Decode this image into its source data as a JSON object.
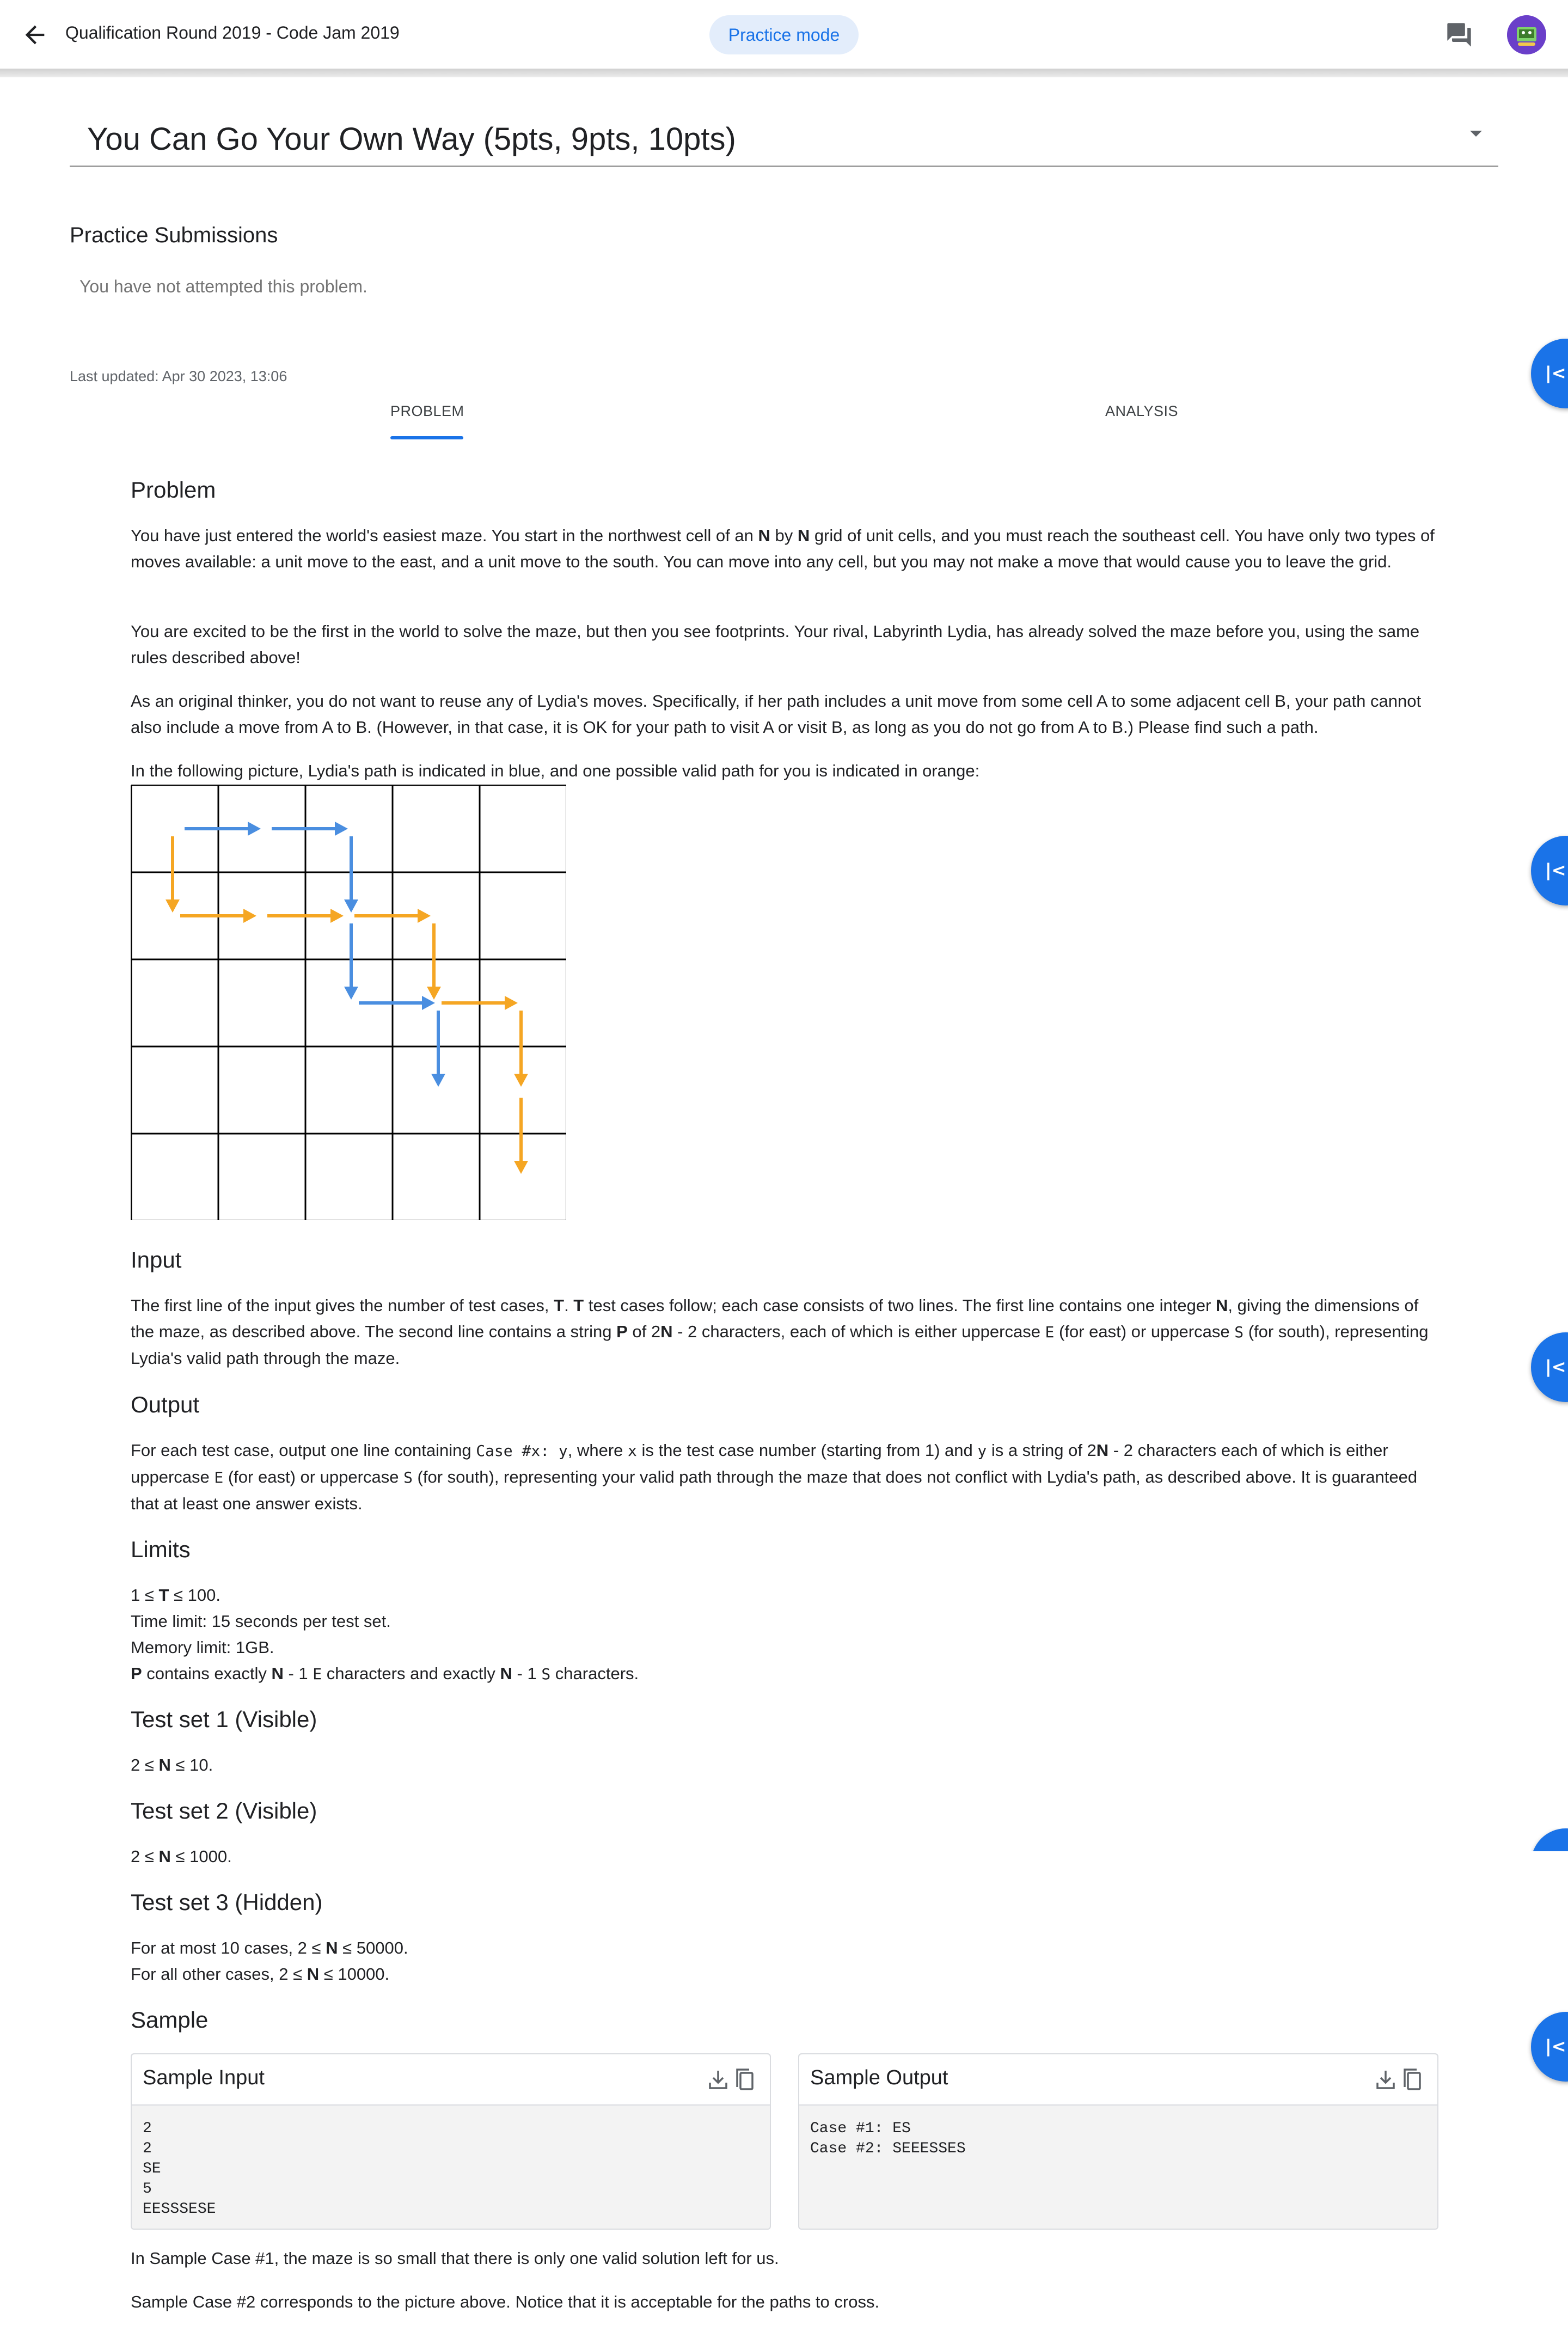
{
  "header": {
    "back_icon": "arrow-back-icon",
    "title": "Qualification Round 2019 - Code Jam 2019",
    "mode_chip": "Practice mode",
    "chat_icon": "chat-icon",
    "avatar_icon": "avatar-icon"
  },
  "problem_select": {
    "value": "You Can Go Your Own Way (5pts, 9pts, 10pts)"
  },
  "submissions": {
    "heading": "Practice Submissions",
    "status": "You have not attempted this problem."
  },
  "last_updated": "Last updated: Apr 30 2023, 13:06",
  "tabs": [
    {
      "label": "PROBLEM",
      "selected": true
    },
    {
      "label": "ANALYSIS",
      "selected": false
    }
  ],
  "fab_icon": "skip-to-start-icon",
  "problem": {
    "heading": "Problem",
    "p1": {
      "a": "You have just entered the world's easiest maze. You start in the northwest cell of an ",
      "n1": "N",
      "b": " by ",
      "n2": "N",
      "c": " grid of unit cells, and you must reach the southeast cell. You have only two types of moves available: a unit move to the east, and a unit move to the south. You can move into any cell, but you may not make a move that would cause you to leave the grid."
    },
    "p2": "You are excited to be the first in the world to solve the maze, but then you see footprints. Your rival, Labyrinth Lydia, has already solved the maze before you, using the same rules described above!",
    "p3": "As an original thinker, you do not want to reuse any of Lydia's moves. Specifically, if her path includes a unit move from some cell A to some adjacent cell B, your path cannot also include a move from A to B. (However, in that case, it is OK for your path to visit A or visit B, as long as you do not go from A to B.) Please find such a path.",
    "p4": "In the following picture, Lydia's path is indicated in blue, and one possible valid path for you is indicated in orange:"
  },
  "maze": {
    "size": 5,
    "lydia_path": "EESSES",
    "your_path": "SEEESESS",
    "colors": {
      "lydia": "#4a8ee0",
      "yours": "#f5a623",
      "grid": "#000000"
    }
  },
  "input": {
    "heading": "Input",
    "a": "The first line of the input gives the number of test cases, ",
    "T1": "T",
    "b": ". ",
    "T2": "T",
    "c": " test cases follow; each case consists of two lines. The first line contains one integer ",
    "N1": "N",
    "d": ", giving the dimensions of the maze, as described above. The second line contains a string ",
    "P": "P",
    "e": " of 2",
    "N2": "N",
    "f": " - 2 characters, each of which is either uppercase ",
    "E": "E",
    "g": " (for east) or uppercase ",
    "S": "S",
    "h": " (for south), representing Lydia's valid path through the maze."
  },
  "output": {
    "heading": "Output",
    "a": "For each test case, output one line containing ",
    "code": "Case #x: y",
    "b": ", where ",
    "x": "x",
    "c": " is the test case number (starting from 1) and ",
    "y": "y",
    "d": " is a string of 2",
    "N": "N",
    "e": " - 2 characters each of which is either uppercase ",
    "E": "E",
    "f": " (for east) or uppercase ",
    "S": "S",
    "g": " (for south), representing your valid path through the maze that does not conflict with Lydia's path, as described above. It is guaranteed that at least one answer exists."
  },
  "limits": {
    "heading": "Limits",
    "l1a": "1 ≤ ",
    "l1T": "T",
    "l1b": " ≤ 100.",
    "l2": "Time limit: 15 seconds per test set.",
    "l3": "Memory limit: 1GB.",
    "l4P": "P",
    "l4a": " contains exactly ",
    "l4N1": "N",
    "l4b": " - 1 ",
    "l4E": "E",
    "l4c": " characters and exactly ",
    "l4N2": "N",
    "l4d": " - 1 ",
    "l4S": "S",
    "l4e": " characters."
  },
  "test_sets": [
    {
      "heading": "Test set 1 (Visible)",
      "a": "2 ≤ ",
      "N": "N",
      "b": " ≤ 10."
    },
    {
      "heading": "Test set 2 (Visible)",
      "a": "2 ≤ ",
      "N": "N",
      "b": " ≤ 1000."
    },
    {
      "heading": "Test set 3 (Hidden)",
      "l1a": "For at most 10 cases, 2 ≤ ",
      "l1N": "N",
      "l1b": " ≤ 50000.",
      "l2a": "For all other cases, 2 ≤ ",
      "l2N": "N",
      "l2b": " ≤ 10000."
    }
  ],
  "sample": {
    "heading": "Sample",
    "input_title": "Sample Input",
    "input_text": "2\n2\nSE\n5\nEESSSESE",
    "output_title": "Sample Output",
    "output_text": "Case #1: ES\nCase #2: SEEESSES",
    "download_icon": "download-icon",
    "copy_icon": "copy-icon",
    "note1": "In Sample Case #1, the maze is so small that there is only one valid solution left for us.",
    "note2": "Sample Case #2 corresponds to the picture above. Notice that it is acceptable for the paths to cross."
  }
}
